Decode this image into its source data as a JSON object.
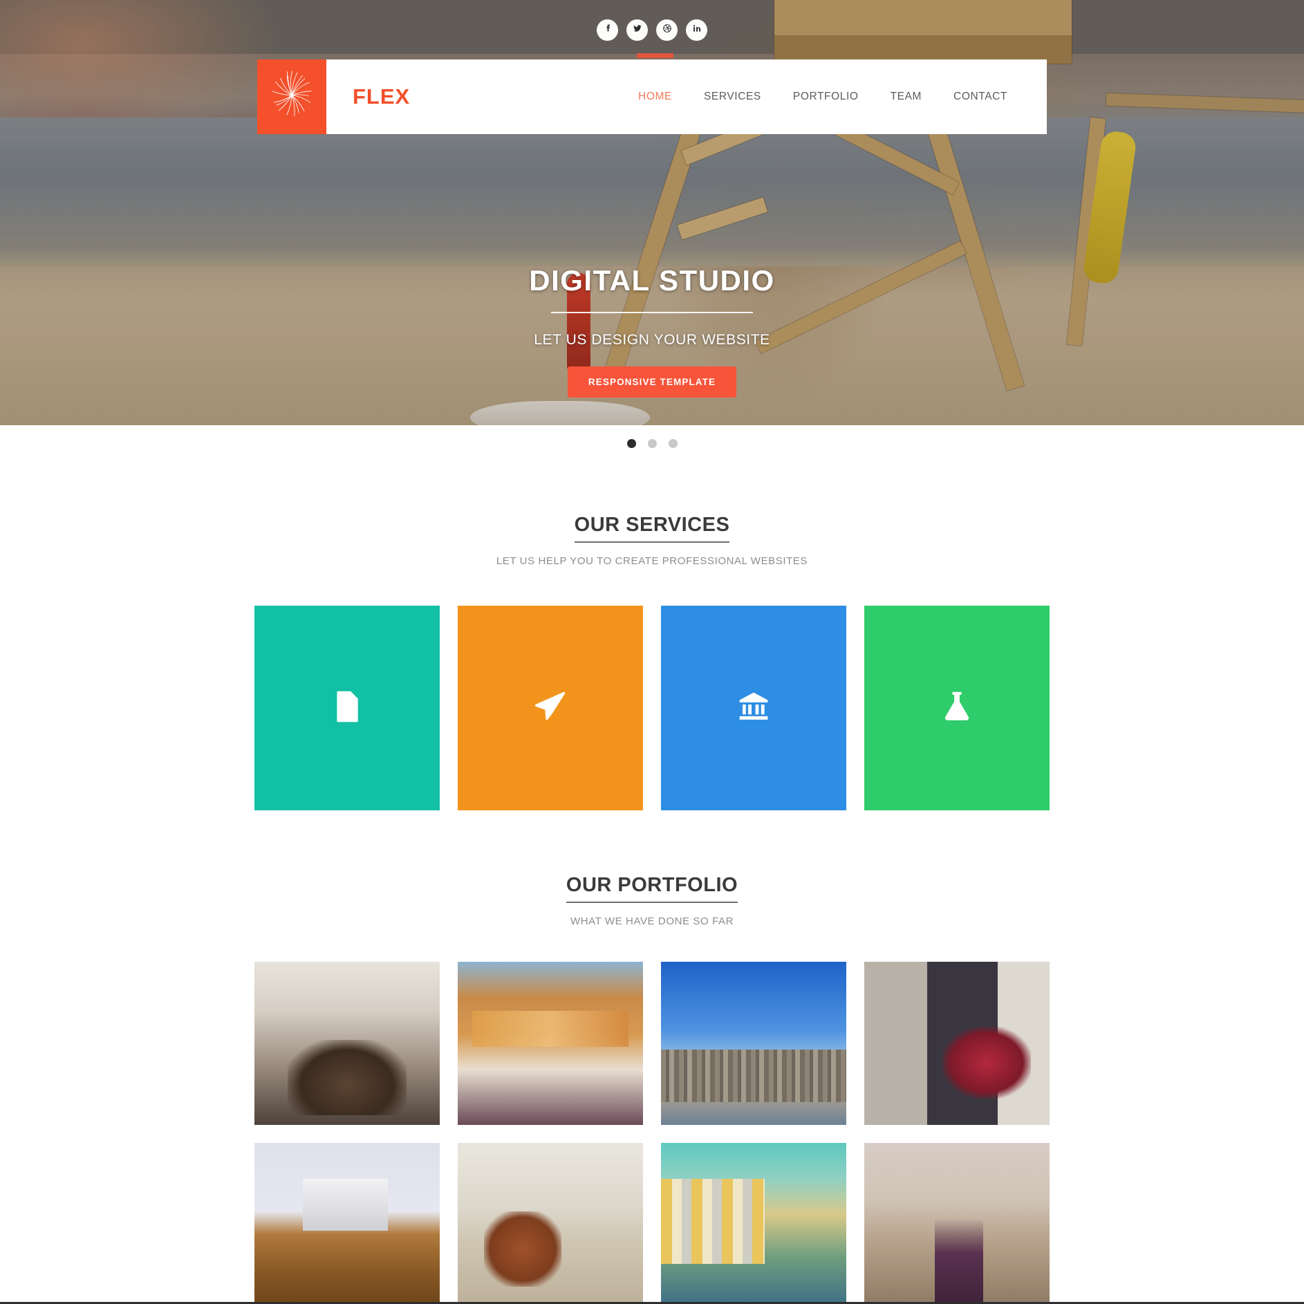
{
  "social": {
    "items": [
      {
        "name": "facebook-icon",
        "label": "f"
      },
      {
        "name": "twitter-icon",
        "label": "t"
      },
      {
        "name": "dribbble-icon",
        "label": "d"
      },
      {
        "name": "linkedin-icon",
        "label": "in"
      }
    ]
  },
  "brand": {
    "name": "FLEX",
    "mark": "flower-logo-icon",
    "accent": "#f4502b"
  },
  "nav": {
    "items": [
      {
        "label": "HOME",
        "active": true
      },
      {
        "label": "SERVICES",
        "active": false
      },
      {
        "label": "PORTFOLIO",
        "active": false
      },
      {
        "label": "TEAM",
        "active": false
      },
      {
        "label": "CONTACT",
        "active": false
      }
    ]
  },
  "hero": {
    "title": "DIGITAL STUDIO",
    "subtitle": "LET US DESIGN YOUR WEBSITE",
    "cta_label": "RESPONSIVE TEMPLATE",
    "cta_color": "#f7543a"
  },
  "carousel": {
    "slides": 3,
    "active_index": 0
  },
  "services": {
    "title": "OUR SERVICES",
    "subtitle": "LET US HELP YOU TO CREATE PROFESSIONAL WEBSITES",
    "tiles": [
      {
        "icon": "code-file-icon",
        "color": "#12c0a5"
      },
      {
        "icon": "paper-plane-icon",
        "color": "#f2941b"
      },
      {
        "icon": "bank-icon",
        "color": "#2e8ee4"
      },
      {
        "icon": "flask-icon",
        "color": "#2ecc6a"
      }
    ]
  },
  "portfolio": {
    "title": "OUR PORTFOLIO",
    "subtitle": "WHAT WE HAVE DONE SO FAR",
    "items": [
      {
        "alt": "street-with-bicycles",
        "style": "ph-street"
      },
      {
        "alt": "sailing-boat-in-harbour",
        "style": "ph-boat"
      },
      {
        "alt": "city-skyline",
        "style": "ph-city"
      },
      {
        "alt": "red-tricycle-on-steps",
        "style": "ph-trike"
      },
      {
        "alt": "laptop-and-glasses-on-desk",
        "style": "ph-desk"
      },
      {
        "alt": "highland-cow-on-dunes",
        "style": "ph-cow"
      },
      {
        "alt": "canal-houses-with-boats",
        "style": "ph-canal"
      },
      {
        "alt": "railway-track",
        "style": "ph-rail"
      }
    ]
  }
}
